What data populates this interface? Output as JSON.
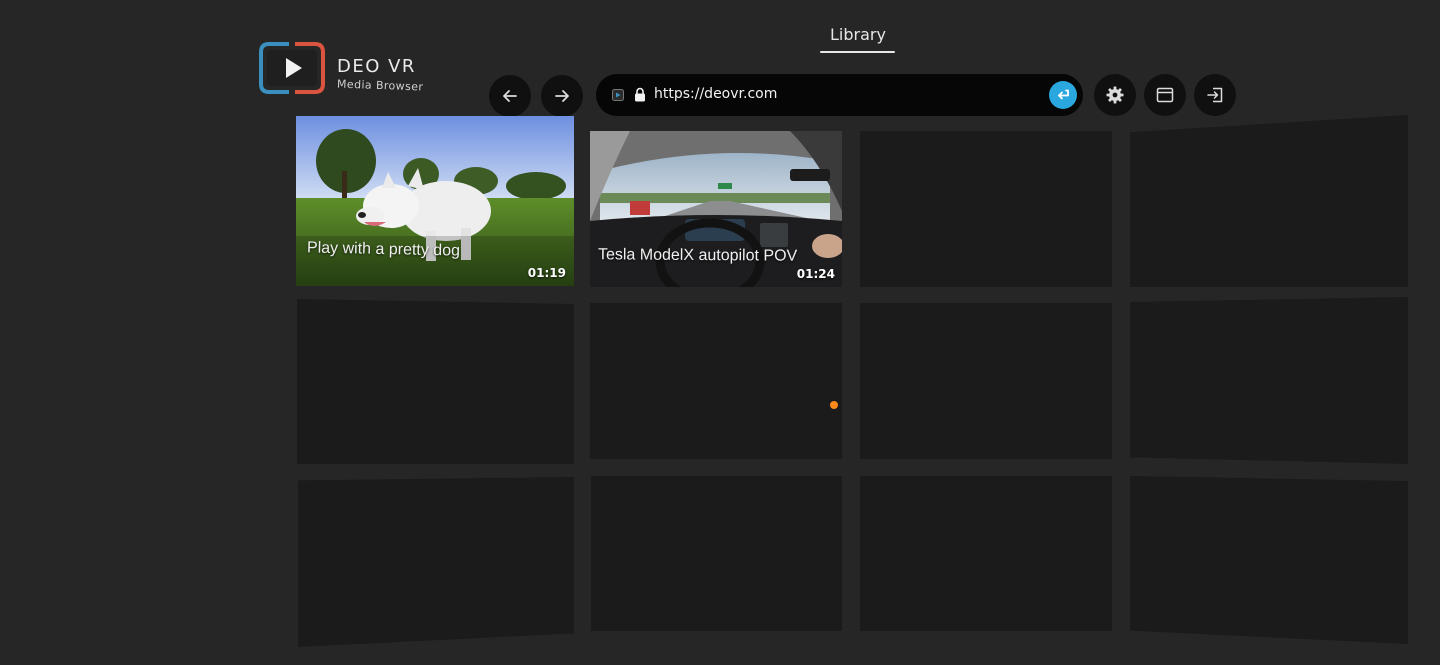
{
  "app": {
    "brand_title": "DEO VR",
    "brand_subtitle": "Media Browser",
    "logo_icon": "play-icon"
  },
  "tabs": [
    {
      "label": "Library",
      "active": true
    }
  ],
  "toolbar": {
    "back_icon": "arrow-left-icon",
    "forward_icon": "arrow-right-icon",
    "settings_icon": "gear-icon",
    "window_icon": "browser-window-icon",
    "exit_icon": "exit-icon"
  },
  "address_bar": {
    "url": "https://deovr.com",
    "secure_icon": "lock-icon",
    "go_icon": "enter-icon"
  },
  "videos": [
    {
      "title": "Play with a pretty dog",
      "duration": "01:19"
    },
    {
      "title": "Tesla ModelX autopilot POV",
      "duration": "01:24"
    }
  ],
  "colors": {
    "background": "#262626",
    "tile": "#1b1b1b",
    "accent": "#2aa7df",
    "logo_blue": "#3a8fbf",
    "logo_red": "#d9553f",
    "cursor": "#ff8a1c"
  }
}
